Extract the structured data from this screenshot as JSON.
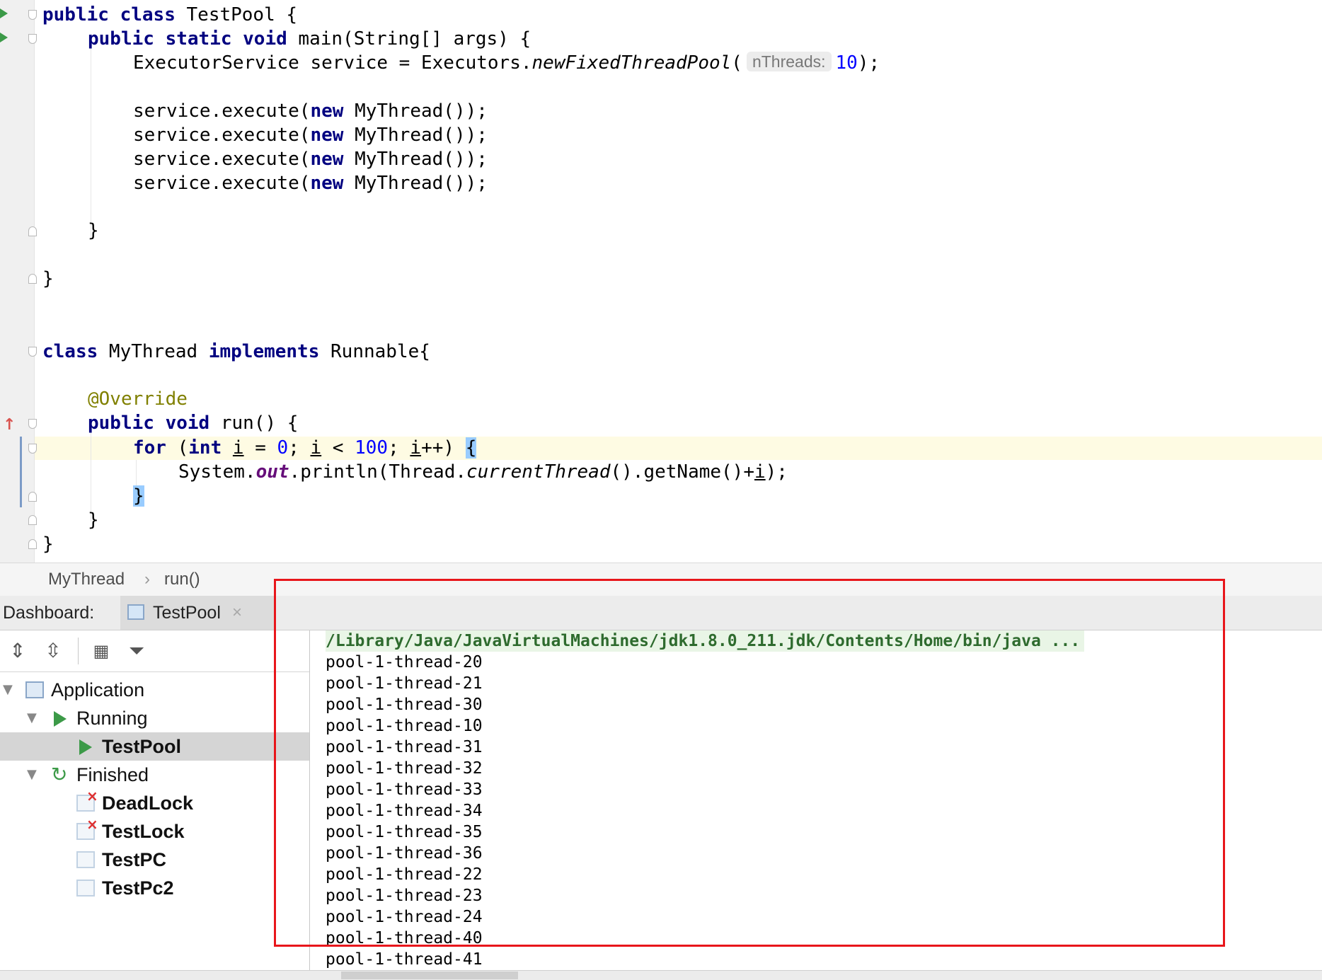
{
  "editor": {
    "lines": [
      {
        "type": "class_decl",
        "kw1": "public",
        "kw2": "class",
        "name": "TestPool",
        "tail": " {"
      },
      {
        "type": "main_decl",
        "kw1": "public",
        "kw2": "static",
        "kw3": "void",
        "rest": " main(String[] args) {"
      },
      {
        "type": "executor",
        "pre": "ExecutorService service = Executors.",
        "method": "newFixedThreadPool",
        "paren": "(",
        "hint": "nThreads:",
        "num": "10",
        "tail": ");"
      },
      {
        "type": "execute",
        "pre": "service.execute(",
        "kw": "new",
        "tail": " MyThread());"
      },
      {
        "type": "execute",
        "pre": "service.execute(",
        "kw": "new",
        "tail": " MyThread());"
      },
      {
        "type": "execute",
        "pre": "service.execute(",
        "kw": "new",
        "tail": " MyThread());"
      },
      {
        "type": "execute",
        "pre": "service.execute(",
        "kw": "new",
        "tail": " MyThread());"
      },
      {
        "type": "brace",
        "text": "}"
      },
      {
        "type": "brace",
        "text": "}"
      },
      {
        "type": "class2",
        "kw1": "class",
        "name": " MyThread ",
        "kw2": "implements",
        "tail": " Runnable{"
      },
      {
        "type": "annotation",
        "text": "@Override"
      },
      {
        "type": "run_decl",
        "kw1": "public",
        "kw2": "void",
        "rest": " run() {"
      },
      {
        "type": "for",
        "kw": "for",
        "p1": " (",
        "kw2": "int",
        "v1": "i",
        "op1": " = ",
        "n1": "0",
        "s1": "; ",
        "v2": "i",
        "op2": " < ",
        "n2": "100",
        "s2": "; ",
        "v3": "i",
        "inc": "++) ",
        "brace": "{"
      },
      {
        "type": "println",
        "pre": "System.",
        "field": "out",
        "mid": ".println(Thread.",
        "method": "currentThread",
        "post": "().getName()+",
        "var": "i",
        "tail": ");"
      },
      {
        "type": "brace_hl",
        "text": "}"
      },
      {
        "type": "brace",
        "text": "}"
      },
      {
        "type": "brace",
        "text": "}"
      }
    ]
  },
  "breadcrumb": {
    "class": "MyThread",
    "sep": "›",
    "method": "run()"
  },
  "dashboard": {
    "label": "Dashboard:",
    "tab": {
      "label": "TestPool",
      "close": "×"
    }
  },
  "toolbar": {
    "icons": [
      "expand-all-icon",
      "collapse-all-icon",
      "group-icon",
      "filter-icon"
    ]
  },
  "tree": {
    "application": "Application",
    "running": "Running",
    "running_item": "TestPool",
    "finished": "Finished",
    "finished_items": [
      "DeadLock",
      "TestLock",
      "TestPC",
      "TestPc2"
    ]
  },
  "console": {
    "command": "/Library/Java/JavaVirtualMachines/jdk1.8.0_211.jdk/Contents/Home/bin/java ...",
    "output": [
      "pool-1-thread-20",
      "pool-1-thread-21",
      "pool-1-thread-30",
      "pool-1-thread-10",
      "pool-1-thread-31",
      "pool-1-thread-32",
      "pool-1-thread-33",
      "pool-1-thread-34",
      "pool-1-thread-35",
      "pool-1-thread-36",
      "pool-1-thread-22",
      "pool-1-thread-23",
      "pool-1-thread-24",
      "pool-1-thread-40",
      "pool-1-thread-41"
    ]
  },
  "colors": {
    "keyword": "#000080",
    "number": "#0000ff",
    "annotation": "#808000",
    "highlight_box": "#e8161b",
    "run_green": "#3c9a48"
  }
}
